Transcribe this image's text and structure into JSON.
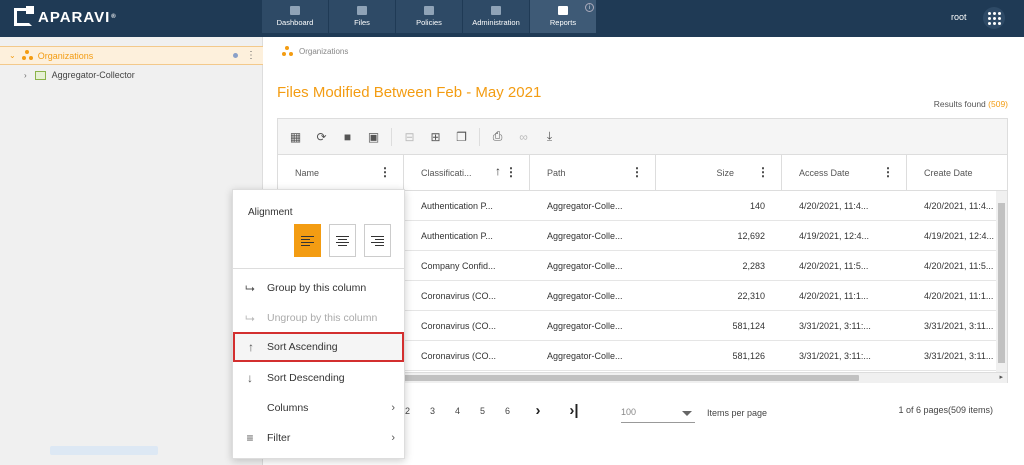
{
  "brand": {
    "name": "APARAVI",
    "mark": "®"
  },
  "nav": {
    "tabs": [
      {
        "label": "Dashboard",
        "icon": "dashboard-icon"
      },
      {
        "label": "Files",
        "icon": "folder-icon"
      },
      {
        "label": "Policies",
        "icon": "gear-icon"
      },
      {
        "label": "Administration",
        "icon": "users-icon"
      },
      {
        "label": "Reports",
        "icon": "clipboard-icon",
        "active": true
      }
    ],
    "info": "i",
    "user": "root"
  },
  "sidebar": {
    "organizations": "Organizations",
    "aggregator": "Aggregator-Collector"
  },
  "breadcrumb": "Organizations",
  "page": {
    "title": "Files Modified Between Feb - May 2021",
    "results_label": "Results found",
    "results_count": "(509)"
  },
  "grid": {
    "columns": [
      "Name",
      "Classificati...",
      "Path",
      "Size",
      "Access Date",
      "Create Date"
    ],
    "rows": [
      {
        "classification": "Authentication P...",
        "path": "Aggregator-Colle...",
        "size": "140",
        "access": "4/20/2021, 11:4...",
        "create": "4/20/2021, 11:4..."
      },
      {
        "classification": "Authentication P...",
        "path": "Aggregator-Colle...",
        "size": "12,692",
        "access": "4/19/2021, 12:4...",
        "create": "4/19/2021, 12:4..."
      },
      {
        "classification": "Company Confid...",
        "path": "Aggregator-Colle...",
        "size": "2,283",
        "access": "4/20/2021, 11:5...",
        "create": "4/20/2021, 11:5..."
      },
      {
        "classification": "Coronavirus (CO...",
        "path": "Aggregator-Colle...",
        "size": "22,310",
        "access": "4/20/2021, 11:1...",
        "create": "4/20/2021, 11:1..."
      },
      {
        "classification": "Coronavirus (CO...",
        "path": "Aggregator-Colle...",
        "size": "581,124",
        "access": "3/31/2021, 3:11:...",
        "create": "3/31/2021, 3:11..."
      },
      {
        "classification": "Coronavirus (CO...",
        "path": "Aggregator-Colle...",
        "size": "581,126",
        "access": "3/31/2021, 3:11:...",
        "create": "3/31/2021, 3:11..."
      }
    ]
  },
  "pager": {
    "pages": [
      "2",
      "3",
      "4",
      "5",
      "6"
    ],
    "next": "›",
    "last": "›|",
    "items_per_page_value": "100",
    "items_per_page_label": "Items per page",
    "info": "1 of 6 pages(509 items)"
  },
  "column_menu": {
    "alignment_title": "Alignment",
    "items": {
      "group": "Group by this column",
      "ungroup": "Ungroup by this column",
      "sort_asc": "Sort Ascending",
      "sort_desc": "Sort Descending",
      "columns": "Columns",
      "filter": "Filter"
    }
  },
  "colors": {
    "accent": "#f39c12",
    "topbar": "#1f3a55",
    "highlight_border": "#d32f2f"
  }
}
